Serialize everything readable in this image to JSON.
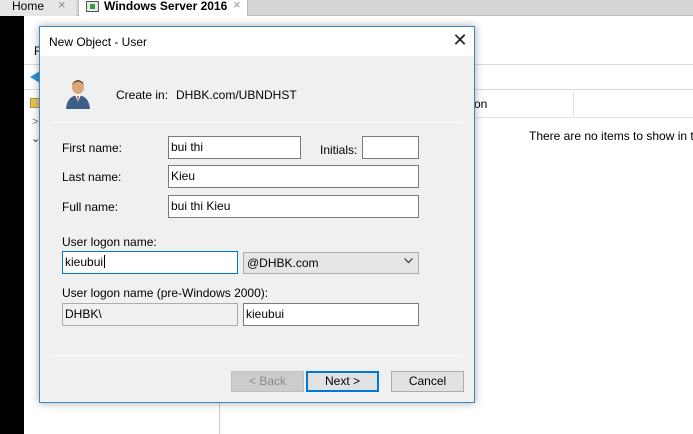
{
  "host": {
    "tabs": [
      {
        "label": "Home"
      },
      {
        "label": "Windows Server 2016"
      }
    ],
    "close_glyph": "×"
  },
  "background": {
    "menu_item": "F",
    "column_header": "on",
    "empty_message": "There are no items to show in t"
  },
  "dialog": {
    "title": "New Object - User",
    "create_in_label": "Create in:",
    "create_in_value": "DHBK.com/UBNDHST",
    "first_name": {
      "label": "First name:",
      "value": "bui thi"
    },
    "initials": {
      "label": "Initials:",
      "value": ""
    },
    "last_name": {
      "label": "Last name:",
      "value": "Kieu"
    },
    "full_name": {
      "label": "Full name:",
      "value": "bui thi Kieu"
    },
    "logon_name": {
      "label": "User logon name:",
      "value": "kieubui"
    },
    "domain": {
      "selected": "@DHBK.com"
    },
    "pre2000": {
      "label": "User logon name (pre-Windows 2000):",
      "domain": "DHBK\\",
      "value": "kieubui"
    },
    "buttons": {
      "back": "< Back",
      "next": "Next >",
      "cancel": "Cancel"
    }
  },
  "colors": {
    "accent": "#0078d7",
    "dialog_border": "#3e85c4",
    "dialog_bg": "#f0f0f0"
  }
}
